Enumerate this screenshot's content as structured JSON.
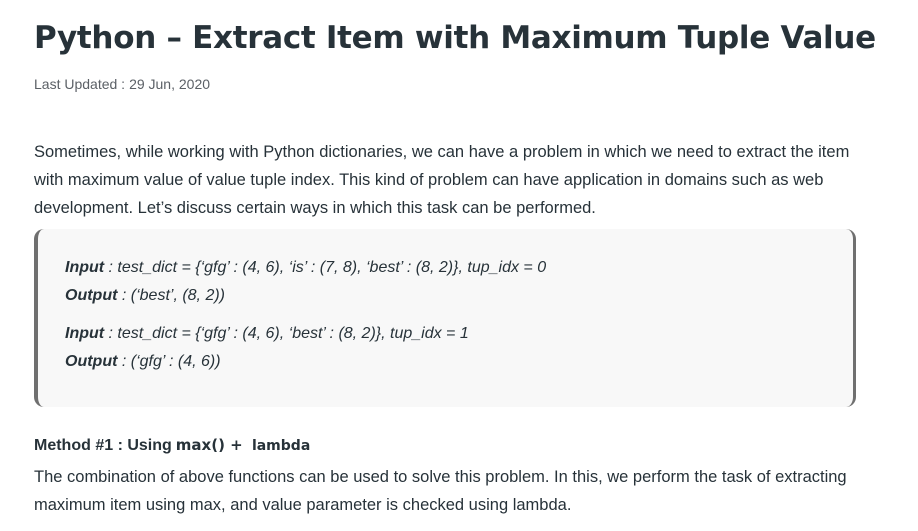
{
  "article": {
    "title": "Python – Extract Item with Maximum Tuple Value",
    "last_updated_label": "Last Updated :",
    "last_updated_date": "29 Jun, 2020",
    "intro": "Sometimes, while working with Python dictionaries, we can have a problem in which we need to extract the item with maximum value of value tuple index. This kind of problem can have application in domains such as web development. Let’s discuss certain ways in which this task can be performed.",
    "examples": [
      {
        "input_label": "Input",
        "input_text": " : test_dict = {‘gfg’ : (4, 6), ‘is’ : (7, 8), ‘best’ : (8, 2)}, tup_idx = 0",
        "output_label": "Output",
        "output_text": " : (‘best’, (8, 2))"
      },
      {
        "input_label": "Input",
        "input_text": " : test_dict = {‘gfg’ : (4, 6), ‘best’ : (8, 2)}, tup_idx = 1",
        "output_label": "Output",
        "output_text": " : (‘gfg’ : (4, 6))"
      }
    ],
    "method": {
      "heading": "Method #1 : Using",
      "code": "max() + ",
      "code_small": "lambda"
    },
    "method_description": "The combination of above functions can be used to solve this problem. In this, we perform the task of extracting maximum item using max, and value parameter is checked using lambda."
  }
}
